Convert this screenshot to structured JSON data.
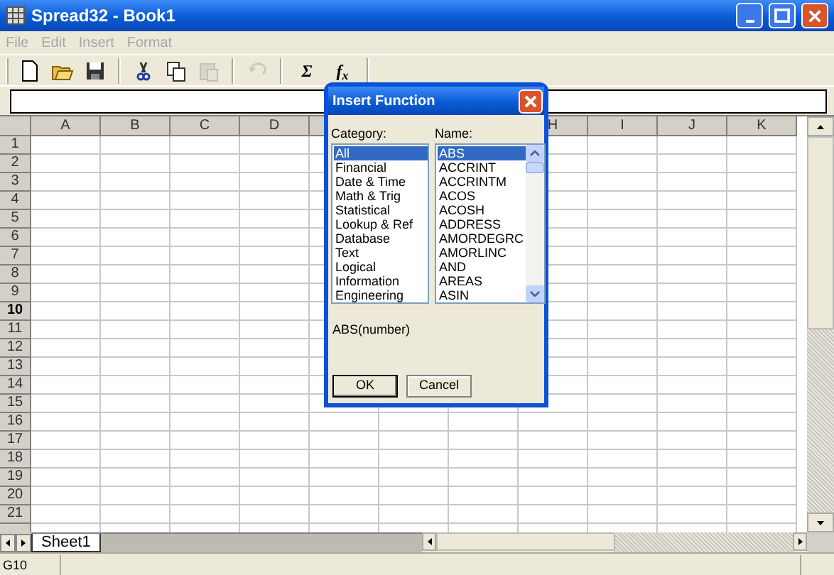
{
  "window": {
    "title": "Spread32 - Book1"
  },
  "menu": [
    {
      "label": "File",
      "disabled": true
    },
    {
      "label": "Edit",
      "disabled": true
    },
    {
      "label": "Insert",
      "disabled": true
    },
    {
      "label": "Format",
      "disabled": true
    }
  ],
  "toolbar": [
    {
      "kind": "icon",
      "disabled": false
    },
    {
      "kind": "icon",
      "disabled": false
    },
    {
      "kind": "icon",
      "disabled": false
    },
    {
      "kind": "separator"
    },
    {
      "kind": "icon",
      "disabled": false
    },
    {
      "kind": "icon",
      "disabled": false
    },
    {
      "kind": "icon",
      "disabled": true
    },
    {
      "kind": "separator"
    },
    {
      "kind": "icon",
      "disabled": true
    },
    {
      "kind": "separator"
    },
    {
      "kind": "text",
      "text": "Σ",
      "disabled": false
    },
    {
      "kind": "text",
      "text": "f$_{x}$",
      "disabled": false
    },
    {
      "kind": "separator"
    }
  ],
  "grid": {
    "columns_left": [
      "A",
      "B",
      "C",
      "D"
    ],
    "columns_right": [
      "H",
      "I",
      "J",
      "K"
    ],
    "rows": [
      {
        "label": "1",
        "selected": false
      },
      {
        "label": "2",
        "selected": false
      },
      {
        "label": "3",
        "selected": false
      },
      {
        "label": "4",
        "selected": false
      },
      {
        "label": "5",
        "selected": false
      },
      {
        "label": "6",
        "selected": false
      },
      {
        "label": "7",
        "selected": false
      },
      {
        "label": "8",
        "selected": false
      },
      {
        "label": "9",
        "selected": false
      },
      {
        "label": "10",
        "selected": true
      },
      {
        "label": "11",
        "selected": false
      },
      {
        "label": "12",
        "selected": false
      },
      {
        "label": "13",
        "selected": false
      },
      {
        "label": "14",
        "selected": false
      },
      {
        "label": "15",
        "selected": false
      },
      {
        "label": "16",
        "selected": false
      },
      {
        "label": "17",
        "selected": false
      },
      {
        "label": "18",
        "selected": false
      },
      {
        "label": "19",
        "selected": false
      },
      {
        "label": "20",
        "selected": false
      },
      {
        "label": "21",
        "selected": false
      }
    ]
  },
  "sheet_tabs": [
    {
      "label": "Sheet1",
      "selected": true
    }
  ],
  "status_bar": {
    "cell": "G10"
  },
  "dialog": {
    "title": "Insert Function",
    "category_label": "Category:",
    "name_label": "Name:",
    "categories": [
      {
        "label": "All",
        "selected": true
      },
      {
        "label": "Financial",
        "selected": false
      },
      {
        "label": "Date & Time",
        "selected": false
      },
      {
        "label": "Math & Trig",
        "selected": false
      },
      {
        "label": "Statistical",
        "selected": false
      },
      {
        "label": "Lookup & Ref",
        "selected": false
      },
      {
        "label": "Database",
        "selected": false
      },
      {
        "label": "Text",
        "selected": false
      },
      {
        "label": "Logical",
        "selected": false
      },
      {
        "label": "Information",
        "selected": false
      },
      {
        "label": "Engineering",
        "selected": false
      }
    ],
    "names": [
      {
        "label": "ABS",
        "selected": true
      },
      {
        "label": "ACCRINT",
        "selected": false
      },
      {
        "label": "ACCRINTM",
        "selected": false
      },
      {
        "label": "ACOS",
        "selected": false
      },
      {
        "label": "ACOSH",
        "selected": false
      },
      {
        "label": "ADDRESS",
        "selected": false
      },
      {
        "label": "AMORDEGRC",
        "selected": false
      },
      {
        "label": "AMORLINC",
        "selected": false
      },
      {
        "label": "AND",
        "selected": false
      },
      {
        "label": "AREAS",
        "selected": false
      },
      {
        "label": "ASIN",
        "selected": false
      }
    ],
    "syntax": "ABS(number)",
    "buttons": [
      "OK",
      "Cancel"
    ]
  }
}
